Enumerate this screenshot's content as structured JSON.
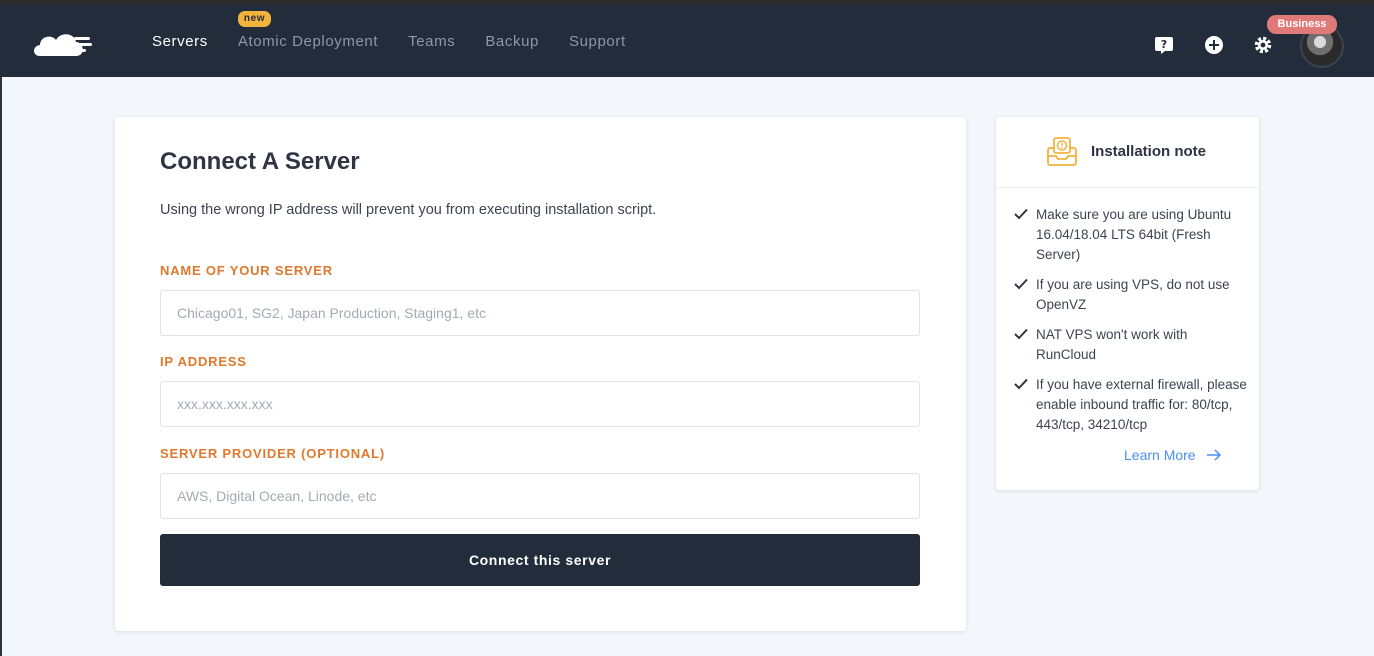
{
  "nav": {
    "items": [
      {
        "label": "Servers",
        "active": true,
        "badge": ""
      },
      {
        "label": "Atomic Deployment",
        "active": false,
        "badge": "new"
      },
      {
        "label": "Teams",
        "active": false,
        "badge": ""
      },
      {
        "label": "Backup",
        "active": false,
        "badge": ""
      },
      {
        "label": "Support",
        "active": false,
        "badge": ""
      }
    ],
    "icons": [
      "help-icon",
      "add-icon",
      "settings-icon"
    ],
    "plan_badge": "Business"
  },
  "form": {
    "title": "Connect A Server",
    "description": "Using the wrong IP address will prevent you from executing installation script.",
    "fields": [
      {
        "label": "NAME OF YOUR SERVER",
        "value": "",
        "placeholder": "Chicago01, SG2, Japan Production, Staging1, etc"
      },
      {
        "label": "IP ADDRESS",
        "value": "",
        "placeholder": "xxx.xxx.xxx.xxx"
      },
      {
        "label": "SERVER PROVIDER (OPTIONAL)",
        "value": "",
        "placeholder": "AWS, Digital Ocean, Linode, etc"
      }
    ],
    "submit_label": "Connect this server"
  },
  "note": {
    "title": "Installation note",
    "items": [
      "Make sure you are using Ubuntu 16.04/18.04 LTS 64bit (Fresh Server)",
      "If you are using VPS, do not use OpenVZ",
      "NAT VPS won't work with RunCloud",
      "If you have external firewall, please enable inbound traffic for: 80/tcp, 443/tcp, 34210/tcp"
    ],
    "learn_more": "Learn More"
  },
  "colors": {
    "topbar": "#232c3a",
    "accent_label": "#e0792d",
    "link": "#4a8ff0",
    "new_badge": "#f2b33c",
    "plan_badge": "#e07a78"
  }
}
